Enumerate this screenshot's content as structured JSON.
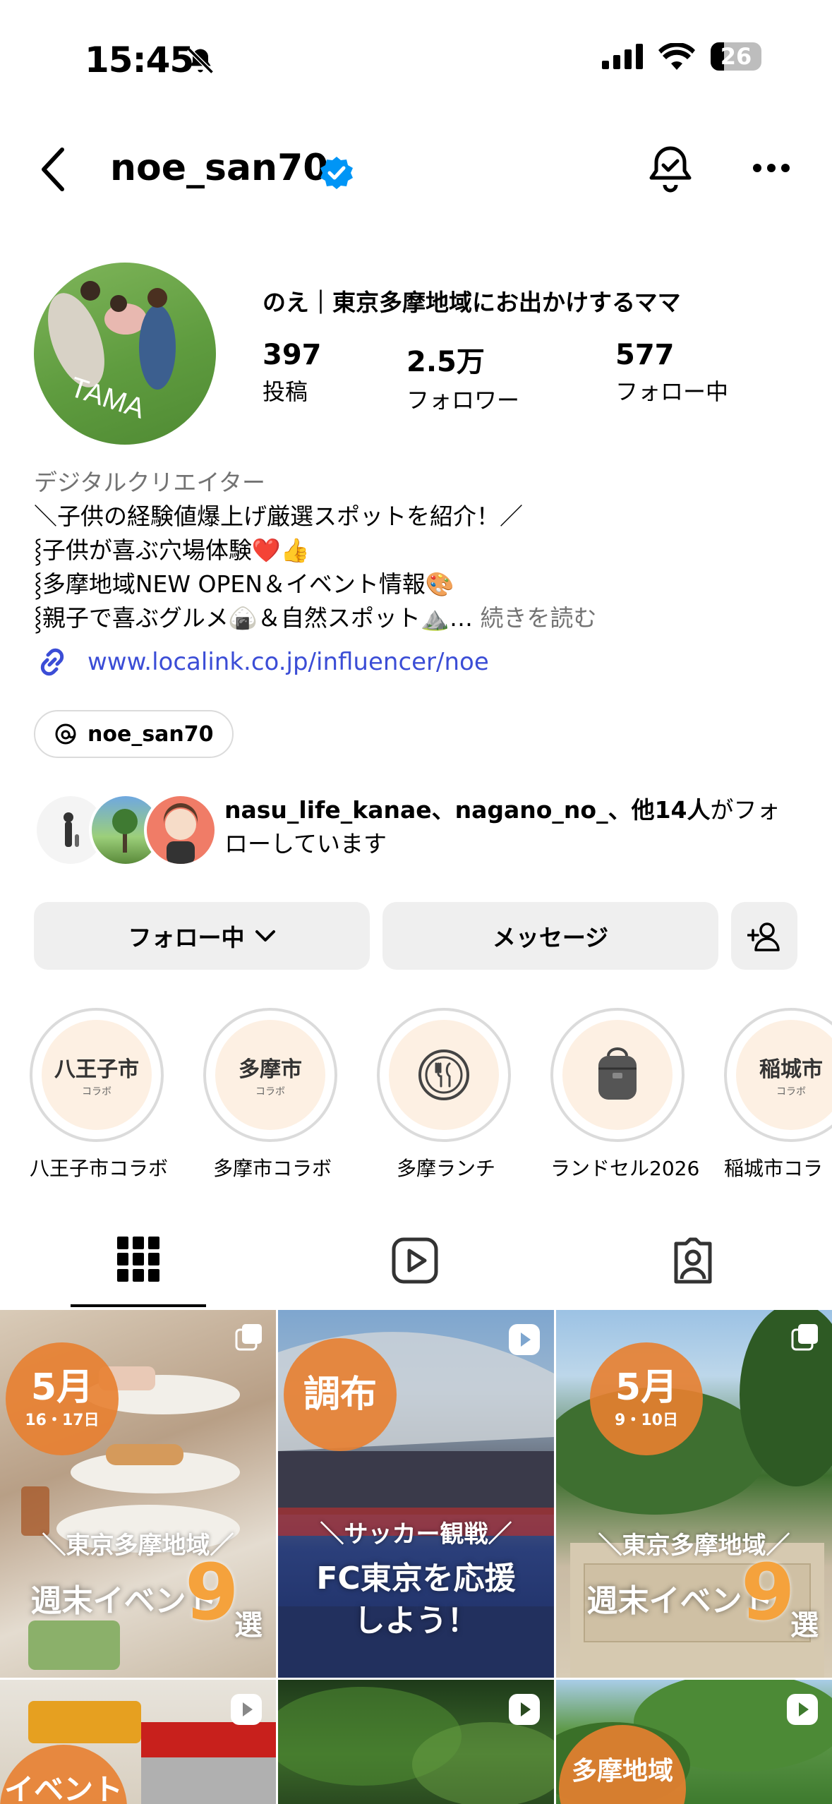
{
  "status_bar": {
    "time": "15:45",
    "battery": "26",
    "battery_level": 0.26
  },
  "header": {
    "username": "noe_san70"
  },
  "profile": {
    "full_name": "のえ｜東京多摩地域にお出かけするママ",
    "avatar_text": "TAMA",
    "stats": [
      {
        "value": "397",
        "label": "投稿"
      },
      {
        "value": "2.5万",
        "label": "フォロワー"
      },
      {
        "value": "577",
        "label": "フォロー中"
      }
    ],
    "category": "デジタルクリエイター",
    "bio_lines": [
      "＼子供の経験値爆上げ厳選スポットを紹介！／",
      "⸾子供が喜ぶ穴場体験❤️👍",
      "⸾多摩地域NEW OPEN＆イベント情報🎨",
      "⸾親子で喜ぶグルメ🍙＆自然スポット⛰️…"
    ],
    "bio_more": "続きを読む",
    "link": "www.localink.co.jp/influencer/noe",
    "threads_handle": "noe_san70",
    "mutual_prefix": "nasu_life_kanae、nagano_no_、他14人",
    "mutual_suffix": "がフォローしています"
  },
  "buttons": {
    "following": "フォロー中",
    "message": "メッセージ"
  },
  "highlights": [
    {
      "title": "八王子市",
      "sub": "コラボ",
      "label": "八王子市コラボ"
    },
    {
      "title": "多摩市",
      "sub": "コラボ",
      "label": "多摩市コラボ"
    },
    {
      "title": "",
      "sub": "",
      "label": "多摩ランチ"
    },
    {
      "title": "",
      "sub": "",
      "label": "ランドセル2026"
    },
    {
      "title": "稲城市",
      "sub": "コラボ",
      "label": "稲城市コラ"
    }
  ],
  "posts": [
    {
      "badge_main": "5月",
      "badge_sub": "16・17日",
      "caption_small": "＼東京多摩地域／",
      "caption_large": "週末イベント",
      "big_number": "9",
      "suffix": "選"
    },
    {
      "badge_main": "調布",
      "badge_sub": "",
      "caption_small": "＼サッカー観戦／",
      "caption_large": "FC東京を応援",
      "caption_large2": "しよう！"
    },
    {
      "badge_main": "5月",
      "badge_sub": "9・10日",
      "caption_small": "＼東京多摩地域／",
      "caption_large": "週末イベント",
      "big_number": "9",
      "suffix": "選"
    },
    {
      "badge_main": "イベント"
    },
    {},
    {
      "badge_main": "多摩地域"
    }
  ],
  "colors": {
    "link": "#3b4dd6",
    "verified": "#0095f6",
    "badge": "#e88030",
    "muted": "#737373",
    "button_bg": "#efefef"
  }
}
